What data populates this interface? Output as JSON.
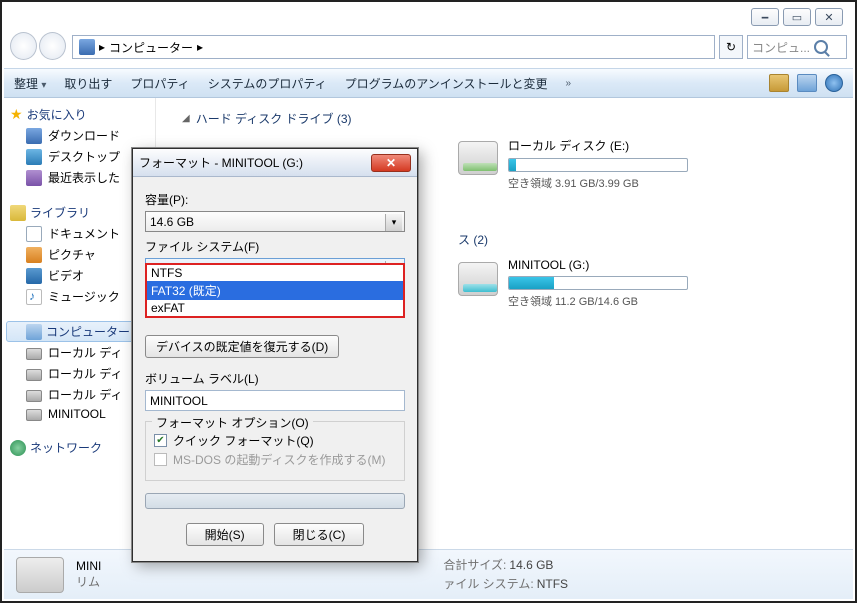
{
  "window": {
    "min": "🗕",
    "max": "▭",
    "close": "✕"
  },
  "address": {
    "location": "コンピューター",
    "sep": "▸",
    "search_placeholder": "コンピュ..."
  },
  "toolbar": {
    "organize": "整理",
    "eject": "取り出す",
    "properties": "プロパティ",
    "sysprops": "システムのプロパティ",
    "uninstall": "プログラムのアンインストールと変更",
    "more": "»"
  },
  "sidebar": {
    "favorites": "お気に入り",
    "downloads": "ダウンロード",
    "desktop": "デスクトップ",
    "recent": "最近表示した",
    "libraries": "ライブラリ",
    "documents": "ドキュメント",
    "pictures": "ピクチャ",
    "videos": "ビデオ",
    "music": "ミュージック",
    "computer": "コンピューター",
    "local1": "ローカル ディ",
    "local2": "ローカル ディ",
    "local3": "ローカル ディ",
    "minitool": "MINITOOL",
    "network": "ネットワーク"
  },
  "sections": {
    "hdd": "ハード ディスク ドライブ (3)",
    "removable": "ス (2)"
  },
  "drives": {
    "e": {
      "name": "ローカル ディスク (E:)",
      "free": "空き領域 3.91 GB/3.99 GB",
      "pct": 4
    },
    "g": {
      "name": "MINITOOL (G:)",
      "free": "空き領域 11.2 GB/14.6 GB",
      "pct": 25
    }
  },
  "status": {
    "name": "MINI",
    "sub": "リム",
    "size_lbl": "合計サイズ:",
    "size": "14.6 GB",
    "fs_lbl": "ァイル システム:",
    "fs": "NTFS"
  },
  "dialog": {
    "title": "フォーマット - MINITOOL (G:)",
    "capacity_lbl": "容量(P):",
    "capacity": "14.6 GB",
    "fs_lbl": "ファイル システム(F)",
    "fs_selected": "NTFS",
    "opts": {
      "ntfs": "NTFS",
      "fat32": "FAT32 (既定)",
      "exfat": "exFAT"
    },
    "alloc_lbl": "",
    "restore": "デバイスの既定値を復元する(D)",
    "vol_lbl": "ボリューム ラベル(L)",
    "vol_value": "MINITOOL",
    "grp_lbl": "フォーマット オプション(O)",
    "quick": "クイック フォーマット(Q)",
    "msdos": "MS-DOS の起動ディスクを作成する(M)",
    "start": "開始(S)",
    "close": "閉じる(C)"
  }
}
